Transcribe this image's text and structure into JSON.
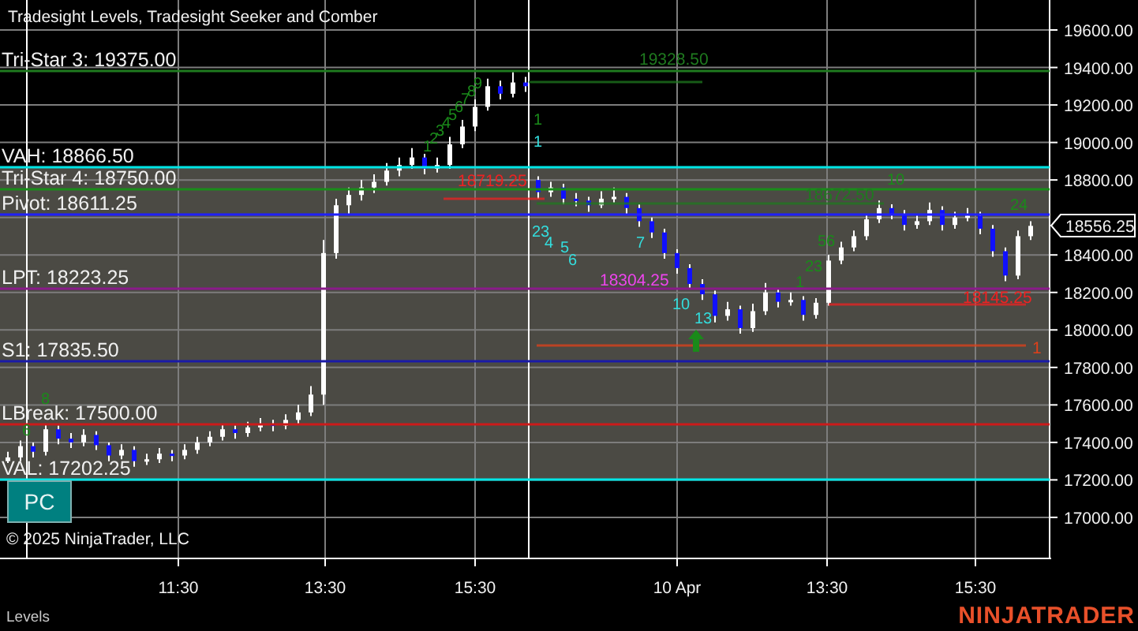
{
  "chart_title": "Tradesight Levels, Tradesight Seeker and Comber",
  "levels": [
    {
      "label": "Tri-Star 3: 19375.00",
      "color": "#1f7a1f"
    },
    {
      "label": "VAH: 18866.50",
      "color": "#00e5e5"
    },
    {
      "label": "Tri-Star 4: 18750.00",
      "color": "#1a8c1a"
    },
    {
      "label": "Pivot: 18611.25",
      "color": "#2020ff"
    },
    {
      "label": "LPT: 18223.25",
      "color": "#8a1a8a"
    },
    {
      "label": "S1: 17835.50",
      "color": "#1a1aa8"
    },
    {
      "label": "LBreak: 17500.00",
      "color": "#cc1a1a"
    },
    {
      "label": "VAL: 17202.25",
      "color": "#00e5e5"
    }
  ],
  "annotations": [
    {
      "text": "18719.25",
      "color": "#ee2222"
    },
    {
      "text": "19328.50",
      "color": "#1f7a1f"
    },
    {
      "text": "18672.50",
      "color": "#1f7a1f"
    },
    {
      "text": "18304.25",
      "color": "#ee44ee"
    },
    {
      "text": "18145.25",
      "color": "#ee2222"
    },
    {
      "text": "1",
      "color": "#e0401a"
    }
  ],
  "counts": [
    {
      "text": "1",
      "color": "#1a8a1a"
    },
    {
      "text": "2",
      "color": "#1a8a1a"
    },
    {
      "text": "3",
      "color": "#1a8a1a"
    },
    {
      "text": "4",
      "color": "#1a8a1a"
    },
    {
      "text": "5",
      "color": "#1a8a1a"
    },
    {
      "text": "6",
      "color": "#1a8a1a"
    },
    {
      "text": "7",
      "color": "#1a8a1a"
    },
    {
      "text": "8",
      "color": "#1a8a1a"
    },
    {
      "text": "9",
      "color": "#1a8a1a"
    },
    {
      "text": "1",
      "color": "#1a8a1a"
    },
    {
      "text": "1",
      "color": "#33dddd"
    },
    {
      "text": "23",
      "color": "#33dddd"
    },
    {
      "text": "4",
      "color": "#33dddd"
    },
    {
      "text": "5",
      "color": "#33dddd"
    },
    {
      "text": "6",
      "color": "#33dddd"
    },
    {
      "text": "7",
      "color": "#33dddd"
    },
    {
      "text": "10",
      "color": "#33dddd"
    },
    {
      "text": "13",
      "color": "#33dddd"
    },
    {
      "text": "8",
      "color": "#1a8a1a"
    },
    {
      "text": "6",
      "color": "#1a8a1a"
    },
    {
      "text": "1",
      "color": "#1a8a1a"
    },
    {
      "text": "23",
      "color": "#1a8a1a"
    },
    {
      "text": "56",
      "color": "#1a8a1a"
    },
    {
      "text": "10",
      "color": "#1a8a1a"
    },
    {
      "text": "24",
      "color": "#1a8a1a"
    }
  ],
  "chart_data": {
    "type": "candlestick",
    "ylim": [
      16781,
      19760
    ],
    "yticks": [
      {
        "value": 19600,
        "label": "19600.00"
      },
      {
        "value": 19400,
        "label": "19400.00"
      },
      {
        "value": 19200,
        "label": "19200.00"
      },
      {
        "value": 19000,
        "label": "19000.00"
      },
      {
        "value": 18800,
        "label": "18800.00"
      },
      {
        "value": 18400,
        "label": "18400.00"
      },
      {
        "value": 18200,
        "label": "18200.00"
      },
      {
        "value": 18000,
        "label": "18000.00"
      },
      {
        "value": 17800,
        "label": "17800.00"
      },
      {
        "value": 17600,
        "label": "17600.00"
      },
      {
        "value": 17400,
        "label": "17400.00"
      },
      {
        "value": 17200,
        "label": "17200.00"
      },
      {
        "value": 17000,
        "label": "17000.00"
      }
    ],
    "grid": true,
    "categories": [
      null,
      null,
      null,
      null,
      null,
      null,
      null,
      null,
      null,
      null,
      null,
      null,
      null,
      null,
      null,
      null,
      null,
      null,
      null,
      null,
      null,
      null,
      null,
      null,
      null,
      null,
      null,
      null,
      null,
      null,
      null,
      null,
      null,
      null,
      null,
      null,
      null,
      null,
      null,
      null,
      null,
      null,
      null,
      null,
      null,
      null,
      null,
      null,
      null,
      null,
      null,
      null,
      null,
      null,
      null,
      null,
      null,
      null,
      null,
      null,
      null,
      null,
      null,
      null,
      null,
      null,
      null,
      null,
      null,
      null,
      null,
      null,
      null,
      null,
      null,
      null,
      null,
      null,
      null,
      null,
      null,
      null
    ],
    "ohlc": [
      [
        17300,
        17350,
        17290,
        17320
      ],
      [
        17320,
        17410,
        17300,
        17380
      ],
      [
        17380,
        17400,
        17320,
        17350
      ],
      [
        17350,
        17500,
        17330,
        17470
      ],
      [
        17470,
        17490,
        17390,
        17420
      ],
      [
        17420,
        17450,
        17370,
        17400
      ],
      [
        17400,
        17470,
        17380,
        17440
      ],
      [
        17440,
        17460,
        17360,
        17385
      ],
      [
        17385,
        17400,
        17300,
        17330
      ],
      [
        17330,
        17390,
        17310,
        17360
      ],
      [
        17360,
        17380,
        17270,
        17300
      ],
      [
        17300,
        17340,
        17280,
        17310
      ],
      [
        17310,
        17370,
        17290,
        17340
      ],
      [
        17340,
        17360,
        17300,
        17330
      ],
      [
        17330,
        17390,
        17310,
        17360
      ],
      [
        17360,
        17430,
        17340,
        17400
      ],
      [
        17400,
        17460,
        17380,
        17430
      ],
      [
        17430,
        17500,
        17410,
        17470
      ],
      [
        17470,
        17490,
        17420,
        17450
      ],
      [
        17450,
        17510,
        17430,
        17480
      ],
      [
        17480,
        17530,
        17460,
        17500
      ],
      [
        17500,
        17520,
        17460,
        17490
      ],
      [
        17490,
        17550,
        17470,
        17520
      ],
      [
        17520,
        17600,
        17500,
        17560
      ],
      [
        17560,
        17700,
        17540,
        17655
      ],
      [
        17655,
        18480,
        17600,
        18410
      ],
      [
        18410,
        18700,
        18380,
        18665
      ],
      [
        18665,
        18760,
        18620,
        18720
      ],
      [
        18720,
        18800,
        18690,
        18760
      ],
      [
        18760,
        18830,
        18730,
        18790
      ],
      [
        18790,
        18890,
        18770,
        18850
      ],
      [
        18850,
        18920,
        18820,
        18880
      ],
      [
        18880,
        18970,
        18860,
        18920
      ],
      [
        18920,
        18940,
        18830,
        18860
      ],
      [
        18860,
        18920,
        18840,
        18880
      ],
      [
        18880,
        19030,
        18860,
        18990
      ],
      [
        18990,
        19120,
        18970,
        19085
      ],
      [
        19085,
        19230,
        19060,
        19190
      ],
      [
        19190,
        19340,
        19170,
        19300
      ],
      [
        19300,
        19330,
        19230,
        19260
      ],
      [
        19260,
        19375,
        19240,
        19320
      ],
      [
        19320,
        19350,
        19270,
        19300
      ],
      [
        18800,
        18820,
        18700,
        18735
      ],
      [
        18735,
        18790,
        18710,
        18760
      ],
      [
        18760,
        18780,
        18670,
        18700
      ],
      [
        18700,
        18730,
        18660,
        18690
      ],
      [
        18690,
        18710,
        18630,
        18665
      ],
      [
        18665,
        18740,
        18650,
        18700
      ],
      [
        18700,
        18760,
        18680,
        18710
      ],
      [
        18710,
        18730,
        18620,
        18650
      ],
      [
        18650,
        18670,
        18550,
        18580
      ],
      [
        18580,
        18600,
        18490,
        18520
      ],
      [
        18520,
        18540,
        18380,
        18410
      ],
      [
        18410,
        18430,
        18300,
        18330
      ],
      [
        18330,
        18350,
        18220,
        18245
      ],
      [
        18245,
        18270,
        18160,
        18190
      ],
      [
        18190,
        18210,
        18040,
        18075
      ],
      [
        18075,
        18150,
        18050,
        18110
      ],
      [
        18110,
        18130,
        17980,
        18010
      ],
      [
        18010,
        18140,
        17990,
        18100
      ],
      [
        18100,
        18250,
        18080,
        18200
      ],
      [
        18200,
        18220,
        18120,
        18150
      ],
      [
        18150,
        18200,
        18130,
        18160
      ],
      [
        18160,
        18180,
        18050,
        18080
      ],
      [
        18080,
        18170,
        18060,
        18145
      ],
      [
        18145,
        18400,
        18130,
        18370
      ],
      [
        18370,
        18470,
        18350,
        18440
      ],
      [
        18440,
        18530,
        18420,
        18500
      ],
      [
        18500,
        18620,
        18480,
        18590
      ],
      [
        18590,
        18690,
        18570,
        18650
      ],
      [
        18650,
        18670,
        18590,
        18620
      ],
      [
        18620,
        18640,
        18530,
        18560
      ],
      [
        18560,
        18610,
        18540,
        18580
      ],
      [
        18580,
        18680,
        18560,
        18640
      ],
      [
        18640,
        18660,
        18530,
        18560
      ],
      [
        18560,
        18630,
        18540,
        18600
      ],
      [
        18600,
        18650,
        18580,
        18610
      ],
      [
        18610,
        18630,
        18510,
        18540
      ],
      [
        18540,
        18560,
        18390,
        18420
      ],
      [
        18420,
        18440,
        18260,
        18290
      ],
      [
        18290,
        18530,
        18270,
        18500
      ],
      [
        18500,
        18580,
        18480,
        18555
      ]
    ]
  },
  "time_axis": [
    "11:30",
    "13:30",
    "15:30",
    "10 Apr",
    "13:30",
    "15:30"
  ],
  "current_price": "18556.25",
  "pc_button": "PC",
  "copyright": "© 2025 NinjaTrader, LLC",
  "panel_tab": "Levels",
  "brand": "NINJATRADER"
}
